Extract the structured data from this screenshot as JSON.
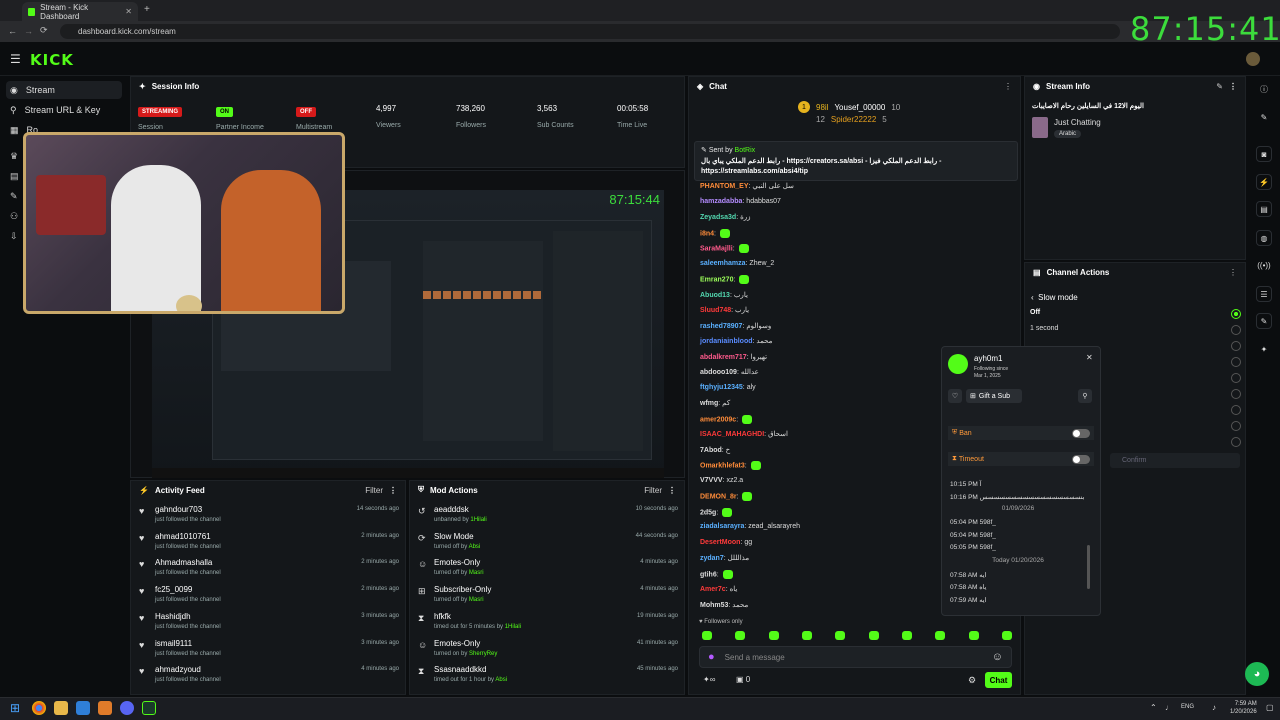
{
  "browser": {
    "tab_title": "Stream - Kick Dashboard",
    "url": "dashboard.kick.com/stream",
    "overlay_clock": "87:15:41"
  },
  "brand": {
    "logo_text": "KICK",
    "accent": "#53fc18"
  },
  "nav": {
    "items": [
      {
        "label": "Stream"
      },
      {
        "label": "Stream URL & Key"
      },
      {
        "label": "Ro"
      }
    ]
  },
  "session": {
    "title": "Session Info",
    "status": [
      {
        "label": "STREAMING",
        "sub": "Session",
        "color": "#d61a1a"
      },
      {
        "label": "ON",
        "sub": "Partner Income",
        "color": "#53fc18"
      },
      {
        "label": "OFF",
        "sub": "Multistream",
        "color": "#d61a1a"
      }
    ],
    "stats": [
      {
        "value": "4,997",
        "label": "Viewers"
      },
      {
        "value": "738,260",
        "label": "Followers"
      },
      {
        "value": "3,563",
        "label": "Sub Counts"
      },
      {
        "value": "00:05:58",
        "label": "Time Live"
      }
    ]
  },
  "preview": {
    "overlay_clock": "87:15:44"
  },
  "activity": {
    "title": "Activity Feed",
    "filter": "Filter",
    "rows": [
      {
        "name": "gahndour703",
        "sub": "just followed the channel",
        "time": "14 seconds ago"
      },
      {
        "name": "ahmad1010761",
        "sub": "just followed the channel",
        "time": "2 minutes ago"
      },
      {
        "name": "Ahmadmashalla",
        "sub": "just followed the channel",
        "time": "2 minutes ago"
      },
      {
        "name": "fc25_0099",
        "sub": "just followed the channel",
        "time": "2 minutes ago"
      },
      {
        "name": "Hashidjdh",
        "sub": "just followed the channel",
        "time": "3 minutes ago"
      },
      {
        "name": "ismail9111",
        "sub": "just followed the channel",
        "time": "3 minutes ago"
      },
      {
        "name": "ahmadzyoud",
        "sub": "just followed the channel",
        "time": "4 minutes ago"
      }
    ]
  },
  "mod": {
    "title": "Mod Actions",
    "filter": "Filter",
    "rows": [
      {
        "name": "aeadddsk",
        "sub_pre": "unbanned by",
        "by": "1Hilali",
        "time": "10 seconds ago"
      },
      {
        "name": "Slow Mode",
        "sub_pre": "turned off by",
        "by": "Absi",
        "time": "44 seconds ago"
      },
      {
        "name": "Emotes-Only",
        "sub_pre": "turned off by",
        "by": "Masri",
        "time": "4 minutes ago"
      },
      {
        "name": "Subscriber-Only",
        "sub_pre": "turned off by",
        "by": "Masri",
        "time": "4 minutes ago"
      },
      {
        "name": "hfkfk",
        "sub_pre": "timed out for 5 minutes by",
        "by": "1Hilali",
        "time": "19 minutes ago"
      },
      {
        "name": "Emotes-Only",
        "sub_pre": "turned on by",
        "by": "SherryRey",
        "time": "41 minutes ago"
      },
      {
        "name": "Ssasnaaddkkd",
        "sub_pre": "timed out for 1 hour by",
        "by": "Absi",
        "time": "45 minutes ago"
      }
    ]
  },
  "chat": {
    "title": "Chat",
    "leaders": [
      {
        "rank": "1",
        "count": "98il",
        "name": "Yousef_00000",
        "n": "10"
      },
      {
        "rank": "",
        "count": "12",
        "name": "Spider22222",
        "n": "5"
      }
    ],
    "pinned": {
      "sent_by": "Sent by",
      "bot": "BotRix",
      "text": "رابط الدعم الملكي يباي بال - https://creators.sa/absi - رابط الدعم الملكي فيزا - https://streamlabs.com/absi4/tip"
    },
    "messages": [
      {
        "user": "PHANTOM_EY",
        "color": "#ff8c3a",
        "text": "سل علی النبي"
      },
      {
        "user": "hamzadabba",
        "color": "#b48cff",
        "text": "hdabbas07"
      },
      {
        "user": "Zeyadsa3d",
        "color": "#53d8b0",
        "text": "زرة"
      },
      {
        "user": "i8n4",
        "color": "#ff8c3a",
        "text": ""
      },
      {
        "user": "SaraMajlli",
        "color": "#ff5a8c",
        "text": ""
      },
      {
        "user": "saleemhamza",
        "color": "#5ab0ff",
        "text": "Zhew_2"
      },
      {
        "user": "Emran270",
        "color": "#9cff5a",
        "text": ""
      },
      {
        "user": "Abuod13",
        "color": "#53d8b0",
        "text": "يارب"
      },
      {
        "user": "Sluud748",
        "color": "#ff3a3a",
        "text": "يارب"
      },
      {
        "user": "rashed78907",
        "color": "#5ab0ff",
        "text": "وسوالوم"
      },
      {
        "user": "jordaniainblood",
        "color": "#5a8cff",
        "text": "محمد"
      },
      {
        "user": "abdalkrem717",
        "color": "#ff5a8c",
        "text": "تهيروا"
      },
      {
        "user": "abdooo109",
        "color": "#ddd",
        "text": "عدالله"
      },
      {
        "user": "ftghyju12345",
        "color": "#5ab0ff",
        "text": "aly"
      },
      {
        "user": "wfmg",
        "color": "#ddd",
        "text": "كم"
      },
      {
        "user": "amer2009c",
        "color": "#ff8c3a",
        "text": ""
      },
      {
        "user": "ISAAC_MAHAGHDI",
        "color": "#ff3a3a",
        "text": "اسحاق"
      },
      {
        "user": "7Abod",
        "color": "#ddd",
        "text": "خ"
      },
      {
        "user": "Omarkhlefat3",
        "color": "#ff8c3a",
        "text": ""
      },
      {
        "user": "V7VVV",
        "color": "#ddd",
        "text": "xz2.a"
      },
      {
        "user": "DEMON_8r",
        "color": "#ff8c3a",
        "text": ""
      },
      {
        "user": "2d5g",
        "color": "#ddd",
        "text": ""
      },
      {
        "user": "ziadalsarayra",
        "color": "#5ab0ff",
        "text": "zead_alsarayreh"
      },
      {
        "user": "DesertMoon",
        "color": "#ff3a3a",
        "text": "gg"
      },
      {
        "user": "zydan7",
        "color": "#5ab0ff",
        "text": "مذالللل"
      },
      {
        "user": "gtih6",
        "color": "#ddd",
        "text": ""
      },
      {
        "user": "Amer7c",
        "color": "#ff3a3a",
        "text": "ياه"
      },
      {
        "user": "Mohm53",
        "color": "#ddd",
        "text": "محمد"
      }
    ],
    "followers_only": "Followers only",
    "input_placeholder": "Send a message",
    "send": "Chat",
    "points": "0"
  },
  "stream_info": {
    "title": "Stream Info",
    "stream_title": "اليوم الا12 في السايلين رحام الاصايبات",
    "category": "Just Chatting",
    "tag": "Arabic"
  },
  "channel_actions": {
    "title": "Channel Actions",
    "section": "Slow mode",
    "options": [
      "Off",
      "1 second"
    ],
    "confirm": "Confirm"
  },
  "user_card": {
    "name": "ayh0m1",
    "following_label": "Following since",
    "following_date": "Mar 1, 2025",
    "gift": "Gift a Sub",
    "ban": "Ban",
    "timeout": "Timeout",
    "history": [
      {
        "time": "10:15 PM",
        "text": "آ"
      },
      {
        "time": "10:16 PM",
        "text": "بنسسسسسسسسسسسسسسسسس"
      },
      {
        "sep": "01/09/2026"
      },
      {
        "time": "05:04 PM",
        "text": "598f_"
      },
      {
        "time": "05:04 PM",
        "text": "598f_"
      },
      {
        "time": "05:05 PM",
        "text": "598f_"
      },
      {
        "sep": "Today 01/20/2026"
      },
      {
        "time": "07:58 AM",
        "text": "ايه"
      },
      {
        "time": "07:58 AM",
        "text": "ياه"
      },
      {
        "time": "07:59 AM",
        "text": "ايه"
      }
    ]
  },
  "taskbar": {
    "lang": "ENG",
    "time": "7:59 AM",
    "date": "1/20/2026"
  }
}
